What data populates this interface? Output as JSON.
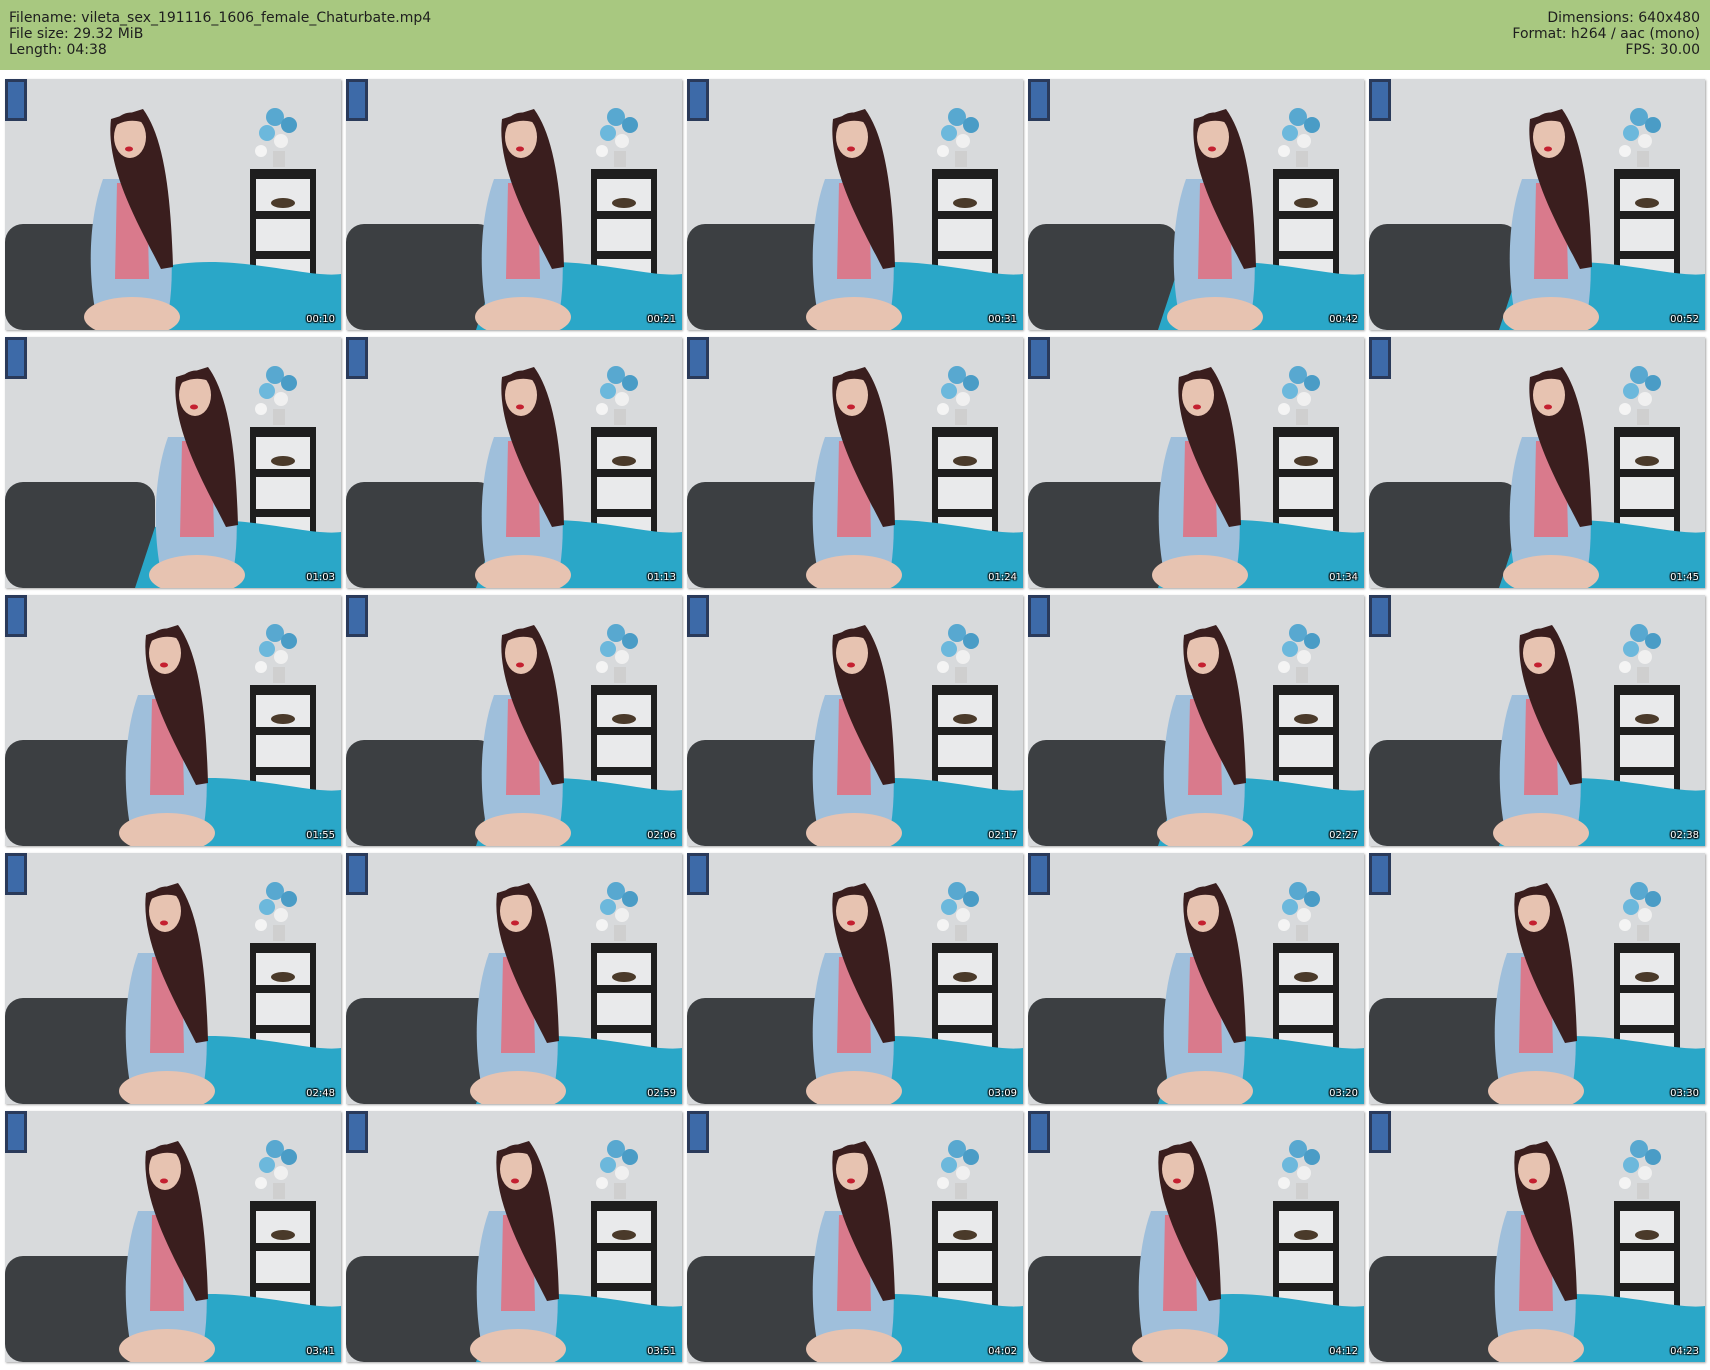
{
  "header": {
    "left": [
      "Filename: vileta_sex_191116_1606_female_Chaturbate.mp4",
      "File size: 29.32 MiB",
      "Length: 04:38"
    ],
    "right": [
      "Dimensions: 640x480",
      "Format: h264 / aac (mono)",
      "FPS: 30.00"
    ]
  },
  "colors": {
    "header_bg": "#a8c880",
    "wall": "#d8dadc",
    "sofa": "#3c3f42",
    "blanket": "#2aa7c8",
    "shelf": "#1e1e1e",
    "hair": "#3a1e1e",
    "vest": "#9fbfdb",
    "blouse": "#d97a8c",
    "skin": "#e7c3b1"
  },
  "thumbnails": [
    {
      "time": "00:10"
    },
    {
      "time": "00:21"
    },
    {
      "time": "00:31"
    },
    {
      "time": "00:42"
    },
    {
      "time": "00:52"
    },
    {
      "time": "01:03"
    },
    {
      "time": "01:13"
    },
    {
      "time": "01:24"
    },
    {
      "time": "01:34"
    },
    {
      "time": "01:45"
    },
    {
      "time": "01:55"
    },
    {
      "time": "02:06"
    },
    {
      "time": "02:17"
    },
    {
      "time": "02:27"
    },
    {
      "time": "02:38"
    },
    {
      "time": "02:48"
    },
    {
      "time": "02:59"
    },
    {
      "time": "03:09"
    },
    {
      "time": "03:20"
    },
    {
      "time": "03:30"
    },
    {
      "time": "03:41"
    },
    {
      "time": "03:51"
    },
    {
      "time": "04:02"
    },
    {
      "time": "04:12"
    },
    {
      "time": "04:23"
    }
  ]
}
